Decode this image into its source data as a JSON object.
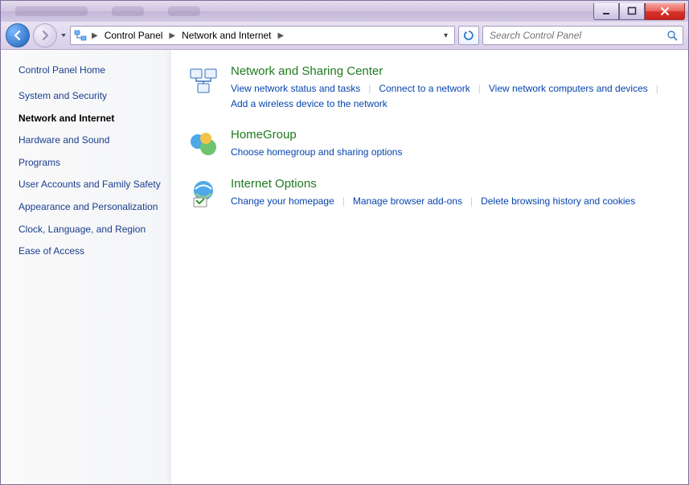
{
  "breadcrumb": {
    "root": "Control Panel",
    "current": "Network and Internet"
  },
  "search": {
    "placeholder": "Search Control Panel"
  },
  "sidebar": {
    "home": "Control Panel Home",
    "items": [
      "System and Security",
      "Network and Internet",
      "Hardware and Sound",
      "Programs",
      "User Accounts and Family Safety",
      "Appearance and Personalization",
      "Clock, Language, and Region",
      "Ease of Access"
    ],
    "current_index": 1
  },
  "categories": [
    {
      "title": "Network and Sharing Center",
      "links": [
        "View network status and tasks",
        "Connect to a network",
        "View network computers and devices",
        "Add a wireless device to the network"
      ]
    },
    {
      "title": "HomeGroup",
      "links": [
        "Choose homegroup and sharing options"
      ]
    },
    {
      "title": "Internet Options",
      "links": [
        "Change your homepage",
        "Manage browser add-ons",
        "Delete browsing history and cookies"
      ]
    }
  ]
}
